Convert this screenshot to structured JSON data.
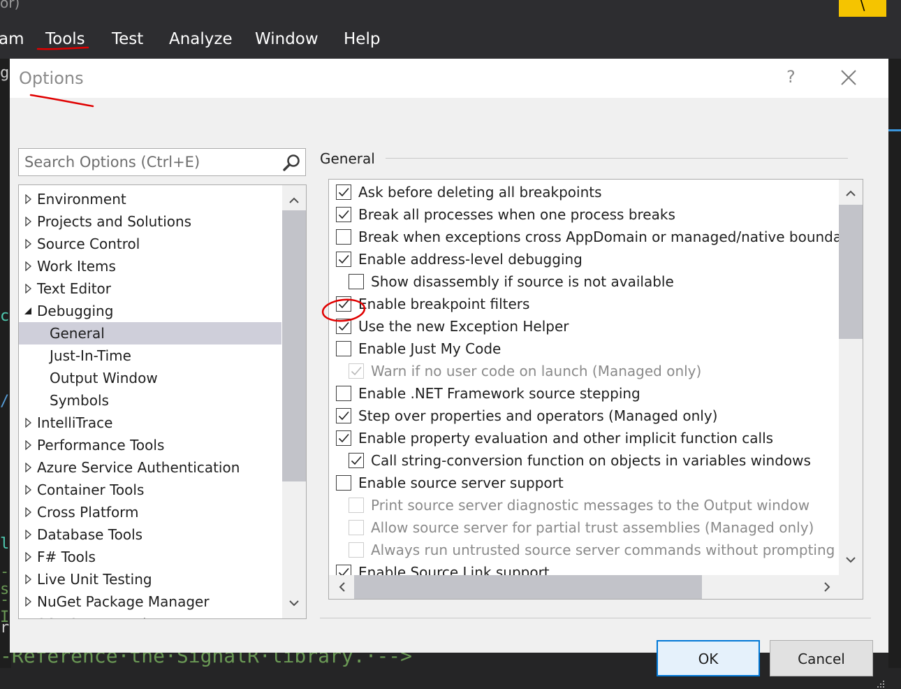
{
  "window": {
    "title_fragment": "or)",
    "menu": [
      "am",
      "Tools",
      "Test",
      "Analyze",
      "Window",
      "Help"
    ],
    "badge": "\\"
  },
  "background_code": {
    "gutter": [
      "g",
      "c)",
      "/",
      "lv",
      "-s",
      "-I",
      "ri"
    ],
    "bottom_line": "-Reference·the·SignalR·library.·-->"
  },
  "dialog": {
    "title": "Options",
    "help": "?",
    "search_placeholder": "Search Options (Ctrl+E)",
    "section_title": "General",
    "ok_label": "OK",
    "cancel_label": "Cancel"
  },
  "tree": [
    {
      "label": "Environment",
      "state": "collapsed",
      "level": 0
    },
    {
      "label": "Projects and Solutions",
      "state": "collapsed",
      "level": 0
    },
    {
      "label": "Source Control",
      "state": "collapsed",
      "level": 0
    },
    {
      "label": "Work Items",
      "state": "collapsed",
      "level": 0
    },
    {
      "label": "Text Editor",
      "state": "collapsed",
      "level": 0
    },
    {
      "label": "Debugging",
      "state": "expanded",
      "level": 0
    },
    {
      "label": "General",
      "state": "leaf",
      "level": 1,
      "selected": true
    },
    {
      "label": "Just-In-Time",
      "state": "leaf",
      "level": 1
    },
    {
      "label": "Output Window",
      "state": "leaf",
      "level": 1
    },
    {
      "label": "Symbols",
      "state": "leaf",
      "level": 1
    },
    {
      "label": "IntelliTrace",
      "state": "collapsed",
      "level": 0
    },
    {
      "label": "Performance Tools",
      "state": "collapsed",
      "level": 0
    },
    {
      "label": "Azure Service Authentication",
      "state": "collapsed",
      "level": 0
    },
    {
      "label": "Container Tools",
      "state": "collapsed",
      "level": 0
    },
    {
      "label": "Cross Platform",
      "state": "collapsed",
      "level": 0
    },
    {
      "label": "Database Tools",
      "state": "collapsed",
      "level": 0
    },
    {
      "label": "F# Tools",
      "state": "collapsed",
      "level": 0
    },
    {
      "label": "Live Unit Testing",
      "state": "collapsed",
      "level": 0
    },
    {
      "label": "NuGet Package Manager",
      "state": "collapsed",
      "level": 0
    },
    {
      "label": "SQL Server Tools",
      "state": "collapsed",
      "level": 0
    }
  ],
  "options": [
    {
      "label": "Ask before deleting all breakpoints",
      "checked": true,
      "indent": 0
    },
    {
      "label": "Break all processes when one process breaks",
      "checked": true,
      "indent": 0
    },
    {
      "label": "Break when exceptions cross AppDomain or managed/native boundaries (Managed only)",
      "checked": false,
      "indent": 0
    },
    {
      "label": "Enable address-level debugging",
      "checked": true,
      "indent": 0
    },
    {
      "label": "Show disassembly if source is not available",
      "checked": false,
      "indent": 1
    },
    {
      "label": "Enable breakpoint filters",
      "checked": true,
      "indent": 0
    },
    {
      "label": "Use the new Exception Helper",
      "checked": true,
      "indent": 0
    },
    {
      "label": "Enable Just My Code",
      "checked": false,
      "indent": 0
    },
    {
      "label": "Warn if no user code on launch (Managed only)",
      "checked": true,
      "indent": 1,
      "disabled": true
    },
    {
      "label": "Enable .NET Framework source stepping",
      "checked": false,
      "indent": 0
    },
    {
      "label": "Step over properties and operators (Managed only)",
      "checked": true,
      "indent": 0
    },
    {
      "label": "Enable property evaluation and other implicit function calls",
      "checked": true,
      "indent": 0
    },
    {
      "label": "Call string-conversion function on objects in variables windows",
      "checked": true,
      "indent": 1
    },
    {
      "label": "Enable source server support",
      "checked": false,
      "indent": 0
    },
    {
      "label": "Print source server diagnostic messages to the Output window",
      "checked": false,
      "indent": 1,
      "disabled": true
    },
    {
      "label": "Allow source server for partial trust assemblies (Managed only)",
      "checked": false,
      "indent": 1,
      "disabled": true
    },
    {
      "label": "Always run untrusted source server commands without prompting",
      "checked": false,
      "indent": 1,
      "disabled": true
    },
    {
      "label": "Enable Source Link support",
      "checked": true,
      "indent": 0
    }
  ],
  "colors": {
    "annotation": "#e00000",
    "accent": "#0078d7"
  }
}
